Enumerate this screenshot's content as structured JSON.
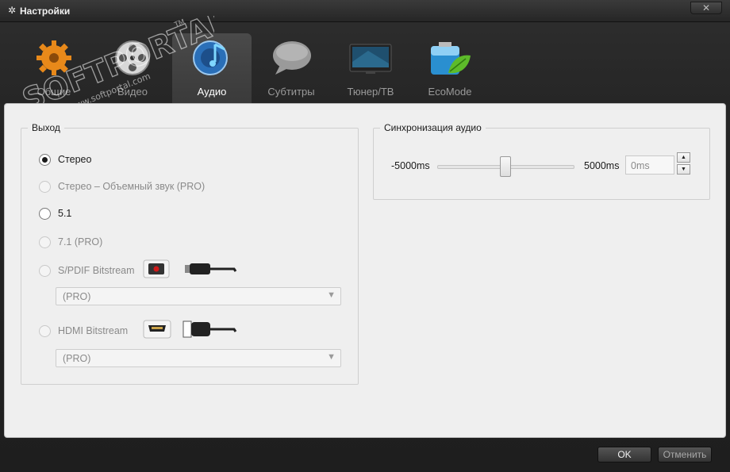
{
  "window": {
    "title": "Настройки",
    "close_label": "✕"
  },
  "tabs": [
    {
      "label": "Общие",
      "icon": "gear-icon",
      "active": false
    },
    {
      "label": "Видео",
      "icon": "film-reel-icon",
      "active": false
    },
    {
      "label": "Аудио",
      "icon": "music-note-icon",
      "active": true
    },
    {
      "label": "Субтитры",
      "icon": "speech-bubble-icon",
      "active": false
    },
    {
      "label": "Тюнер/ТВ",
      "icon": "tv-icon",
      "active": false
    },
    {
      "label": "EcoMode",
      "icon": "battery-leaf-icon",
      "active": false
    }
  ],
  "output": {
    "title": "Выход",
    "options": [
      {
        "label": "Стерео",
        "checked": true,
        "disabled": false
      },
      {
        "label": "Стерео – Объемный звук (PRO)",
        "checked": false,
        "disabled": true
      },
      {
        "label": "5.1",
        "checked": false,
        "disabled": false
      },
      {
        "label": "7.1  (PRO)",
        "checked": false,
        "disabled": true
      },
      {
        "label": "S/PDIF Bitstream",
        "checked": false,
        "disabled": true
      },
      {
        "label": "HDMI Bitstream",
        "checked": false,
        "disabled": true
      }
    ],
    "spdif_select": "(PRO)",
    "hdmi_select": "(PRO)"
  },
  "sync": {
    "title": "Синхронизация аудио",
    "min_label": "-5000ms",
    "max_label": "5000ms",
    "value": "0ms",
    "slider_position": 0.5
  },
  "footer": {
    "ok_label": "OK",
    "cancel_label": "Отменить"
  },
  "watermark": {
    "brand": "SOFTPORTAL",
    "tm": "TM",
    "url": "www.softportal.com"
  }
}
